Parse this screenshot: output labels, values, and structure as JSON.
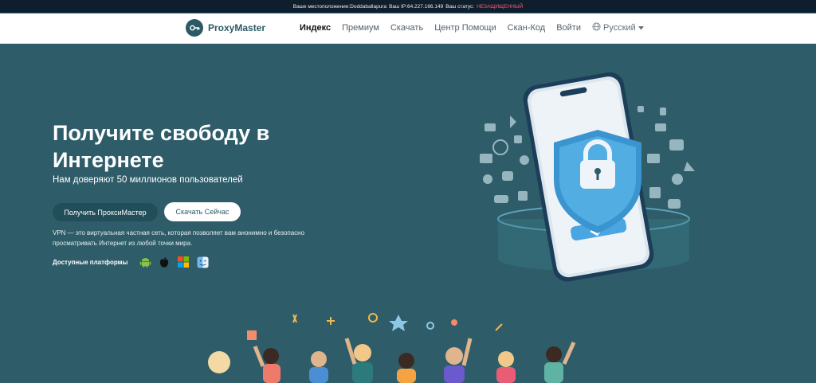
{
  "status_bar": {
    "location_label": "Ваше местоположение:",
    "location": "Doddaballapura",
    "ip_label": "Ваш IP:",
    "ip": "64.227.166.149",
    "status_label": "Ваш статус:",
    "status": "НЕЗАЩИЩЕННЫЙ",
    "status_color": "#ff5a6e"
  },
  "header": {
    "brand": "ProxyMaster",
    "nav": [
      {
        "label": "Индекс",
        "active": true
      },
      {
        "label": "Премиум"
      },
      {
        "label": "Скачать"
      },
      {
        "label": "Центр Помощи"
      },
      {
        "label": "Скан-Код"
      },
      {
        "label": "Войти"
      }
    ],
    "language": "Русский",
    "icons": {
      "brand": "key-icon",
      "language": "globe-icon",
      "dropdown": "caret-down-icon"
    }
  },
  "hero": {
    "title": "Получите свободу в Интернете",
    "subtitle": "Нам доверяют 50 миллионов пользователей",
    "primary_button": "Получить ПроксиМастер",
    "secondary_button": "Скачать Сейчас",
    "description": "VPN — это виртуальная частная сеть, которая позволяет вам анонимно и безопасно просматривать Интернет из любой точки мира.",
    "platforms_label": "Доступные платформы",
    "platforms": [
      "android-icon",
      "apple-icon",
      "windows-icon",
      "macos-finder-icon"
    ],
    "background_color": "#2e5c68"
  }
}
